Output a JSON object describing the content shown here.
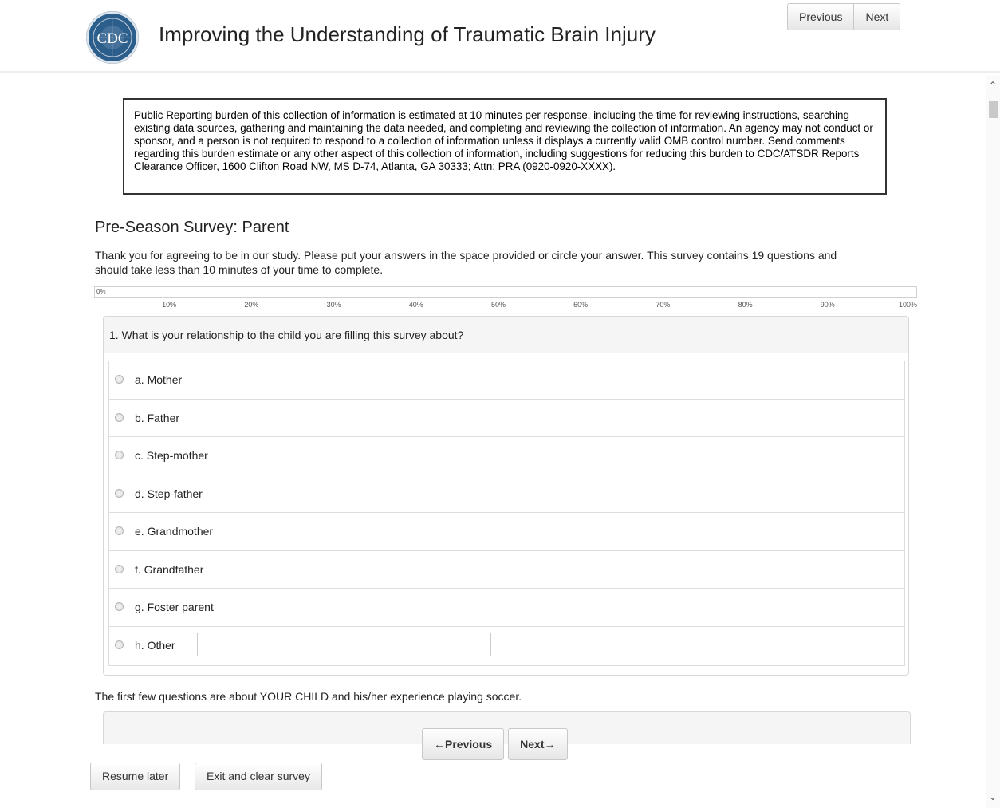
{
  "header": {
    "logo_text": "CDC",
    "title": "Improving the Understanding of Traumatic Brain Injury",
    "previous_label": "Previous",
    "next_label": "Next"
  },
  "burden_statement": "Public Reporting burden of this collection of information is estimated at 10 minutes per response, including the time for reviewing instructions, searching existing data sources, gathering and maintaining the data needed, and completing and reviewing the collection of information.  An agency may not conduct or sponsor, and a person is not required to respond to a collection of information unless it displays a currently valid OMB control number.  Send comments regarding this burden estimate or any other aspect of this collection of information, including suggestions for reducing this burden to CDC/ATSDR Reports Clearance Officer, 1600 Clifton Road NW, MS D-74, Atlanta, GA  30333; Attn:  PRA (0920-0920-XXXX).",
  "survey": {
    "title": "Pre-Season Survey: Parent",
    "intro": "Thank you for agreeing to be in our study. Please put your answers in the space provided or circle your answer. This survey contains 19 questions and should take less than 10 minutes of your time to complete."
  },
  "progress": {
    "value": 0,
    "current_label": "0%",
    "ticks": [
      "10%",
      "20%",
      "30%",
      "40%",
      "50%",
      "60%",
      "70%",
      "80%",
      "90%",
      "100%"
    ]
  },
  "question1": {
    "text": "1. What is your relationship to the child you are filling this survey about?",
    "options": [
      "a. Mother",
      "b. Father",
      "c. Step-mother",
      "d. Step-father",
      "e. Grandmother",
      "f. Grandfather",
      "g. Foster parent",
      "h. Other"
    ],
    "other_value": ""
  },
  "section_note": "The first few questions are about YOUR CHILD and his/her experience playing soccer.",
  "footer": {
    "previous_label": "←Previous",
    "next_label": "Next→",
    "resume_label": "Resume later",
    "exit_label": "Exit and clear survey"
  },
  "colors": {
    "progress_fill": "#4a90c8",
    "question_header_bg": "#f5f5f5"
  }
}
